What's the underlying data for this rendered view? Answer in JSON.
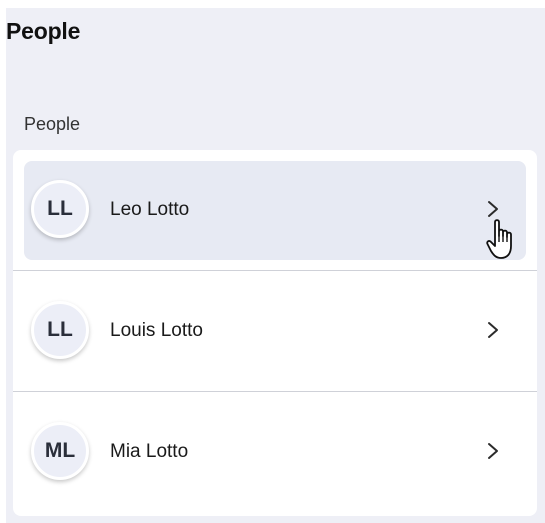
{
  "header": {
    "title": "People"
  },
  "section": {
    "label": "People"
  },
  "people": [
    {
      "initials": "LL",
      "name": "Leo Lotto"
    },
    {
      "initials": "LL",
      "name": "Louis Lotto"
    },
    {
      "initials": "ML",
      "name": "Mia Lotto"
    }
  ],
  "icons": {
    "row_action": "chevron-right-icon",
    "cursor": "hand-pointer-cursor-icon"
  },
  "colors": {
    "panel_background": "#eeeff6",
    "hover_row": "#e7eaf3",
    "avatar_background": "#eceef7",
    "divider": "#cfd1d8"
  }
}
